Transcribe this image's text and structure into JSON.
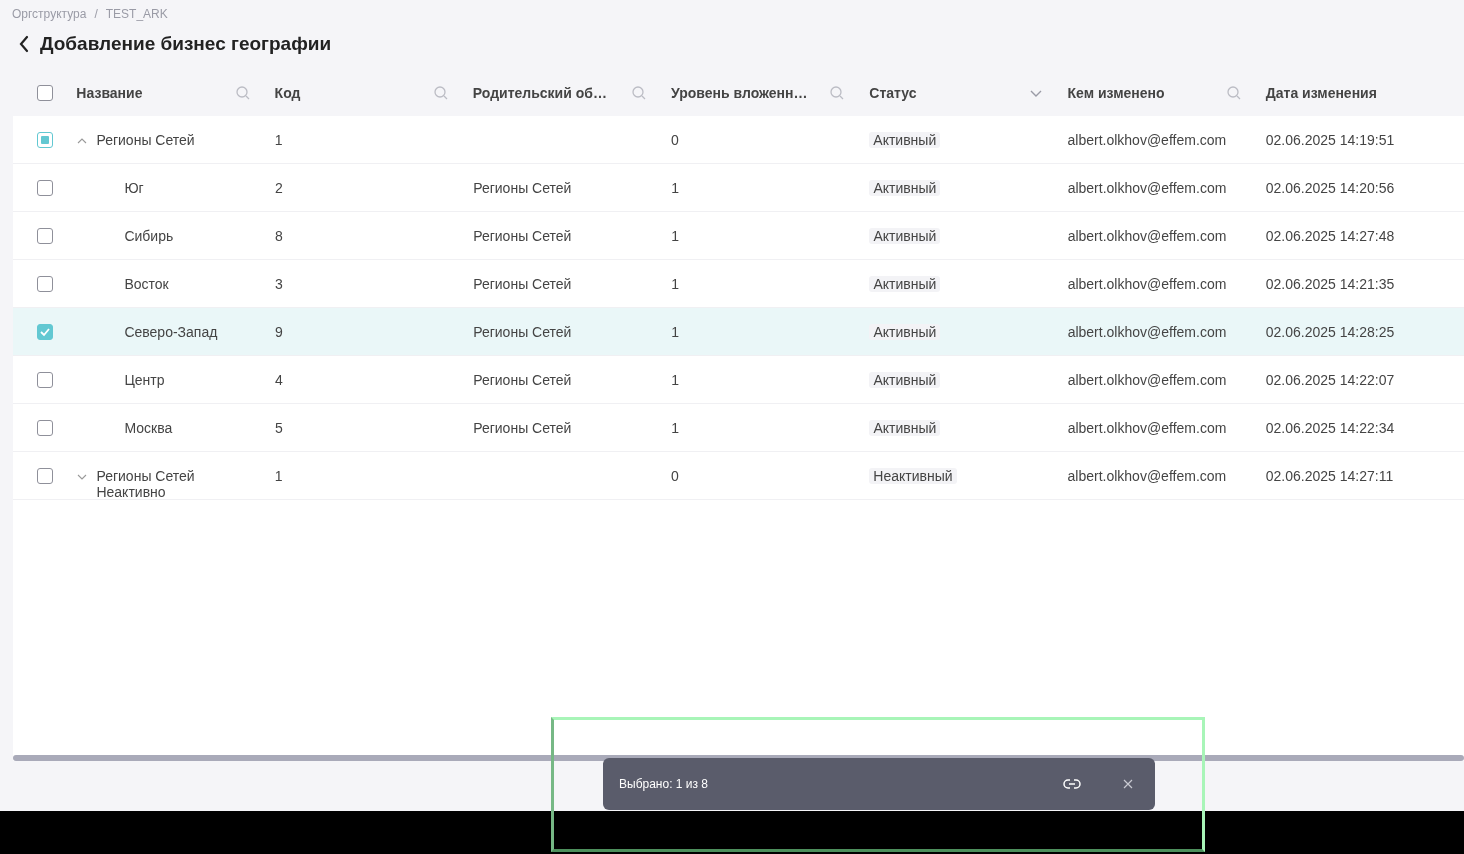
{
  "breadcrumbs": [
    "Оргструктура",
    "TEST_ARK"
  ],
  "breadcrumb_separator": "/",
  "title": "Добавление бизнес географии",
  "table": {
    "header_checkbox": {
      "checked": false
    },
    "columns": [
      {
        "label": "Название",
        "kind": "search"
      },
      {
        "label": "Код",
        "kind": "search"
      },
      {
        "label": "Родительский об…",
        "kind": "search"
      },
      {
        "label": "Уровень вложенн…",
        "kind": "search"
      },
      {
        "label": "Статус",
        "kind": "dropdown"
      },
      {
        "label": "Кем изменено",
        "kind": "search"
      },
      {
        "label": "Дата изменения",
        "kind": "plain"
      }
    ],
    "rows": [
      {
        "name": "Регионы Сетей",
        "code": "1",
        "level_text": "0",
        "status": "Активный",
        "changed_by": "albert.olkhov@effem.com",
        "changed_at": "02.06.2025 14:19:51",
        "checked": false,
        "partial": true,
        "expanded": true,
        "children": [
          {
            "name": "Юг",
            "code": "2",
            "parent": "Регионы Сетей",
            "level_text": "1",
            "status": "Активный",
            "changed_by": "albert.olkhov@effem.com",
            "changed_at": "02.06.2025 14:20:56",
            "checked": false
          },
          {
            "name": "Сибирь",
            "code": "8",
            "parent": "Регионы Сетей",
            "level_text": "1",
            "status": "Активный",
            "changed_by": "albert.olkhov@effem.com",
            "changed_at": "02.06.2025 14:27:48",
            "checked": false
          },
          {
            "name": "Восток",
            "code": "3",
            "parent": "Регионы Сетей",
            "level_text": "1",
            "status": "Активный",
            "changed_by": "albert.olkhov@effem.com",
            "changed_at": "02.06.2025 14:21:35",
            "checked": false
          },
          {
            "name": "Северо-Запад",
            "code": "9",
            "parent": "Регионы Сетей",
            "level_text": "1",
            "status": "Активный",
            "changed_by": "albert.olkhov@effem.com",
            "changed_at": "02.06.2025 14:28:25",
            "checked": true
          },
          {
            "name": "Центр",
            "code": "4",
            "parent": "Регионы Сетей",
            "level_text": "1",
            "status": "Активный",
            "changed_by": "albert.olkhov@effem.com",
            "changed_at": "02.06.2025 14:22:07",
            "checked": false
          },
          {
            "name": "Москва",
            "code": "5",
            "parent": "Регионы Сетей",
            "level_text": "1",
            "status": "Активный",
            "changed_by": "albert.olkhov@effem.com",
            "changed_at": "02.06.2025 14:22:34",
            "checked": false
          }
        ]
      },
      {
        "name": "Регионы Сетей Неактивно",
        "code": "1",
        "level_text": "0",
        "status": "Неактивный",
        "changed_by": "albert.olkhov@effem.com",
        "changed_at": "02.06.2025 14:27:11",
        "checked": false,
        "partial": false,
        "expanded": false
      }
    ]
  },
  "selection_bar": {
    "text": "Выбрано: 1 из 8"
  }
}
